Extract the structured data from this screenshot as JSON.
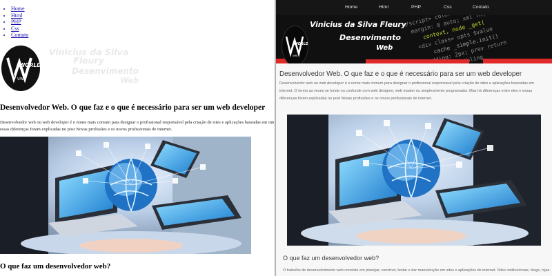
{
  "nav": {
    "items": [
      {
        "label": "Home"
      },
      {
        "label": "Html"
      },
      {
        "label": "PHP"
      },
      {
        "label": "Css"
      },
      {
        "label": "Contato"
      }
    ]
  },
  "banner": {
    "line1": "Vinicius da Silva Fleury",
    "line2": "Desenvimento",
    "line3": "Web"
  },
  "logo": {
    "top": "WORLD",
    "bottom": "VINI"
  },
  "article": {
    "title": "Desenvolvedor Web. O que faz e o que é necessário para ser um web developer",
    "paragraph": "Desenvolvedor web ou web developer é o nome mais comum para designar o profissional responsável pela criação de sites e aplicações baseadas em internet. O termo as vezes se funde ou confunde com web designer, web master ou simplesmente programador. Mas há diferenças entre eles e essas diferenças foram explicadas no post Novas profissões e os novos profissionais de internet.",
    "left_paragraph": "Desenvolvedor web ou web developer é o nome mais comum para designar o profissional responsável pela criação de sites e aplicações baseadas em internet. ... essas diferenças foram explicadas no post Novas profissões e os novos profissionais de internet.",
    "subtitle": "O que faz um desenvolvedor web?",
    "paragraph2": "O trabalho de desenvolvimento web consiste em planejar, construir, testar e dar manutenção em sites e aplicações de internet. Sites institucionais, blogs, lojas"
  },
  "colors": {
    "nav_bg": "#161616",
    "link": "#1a0dab",
    "heading": "#3a3a3a",
    "body_text": "#666666"
  }
}
